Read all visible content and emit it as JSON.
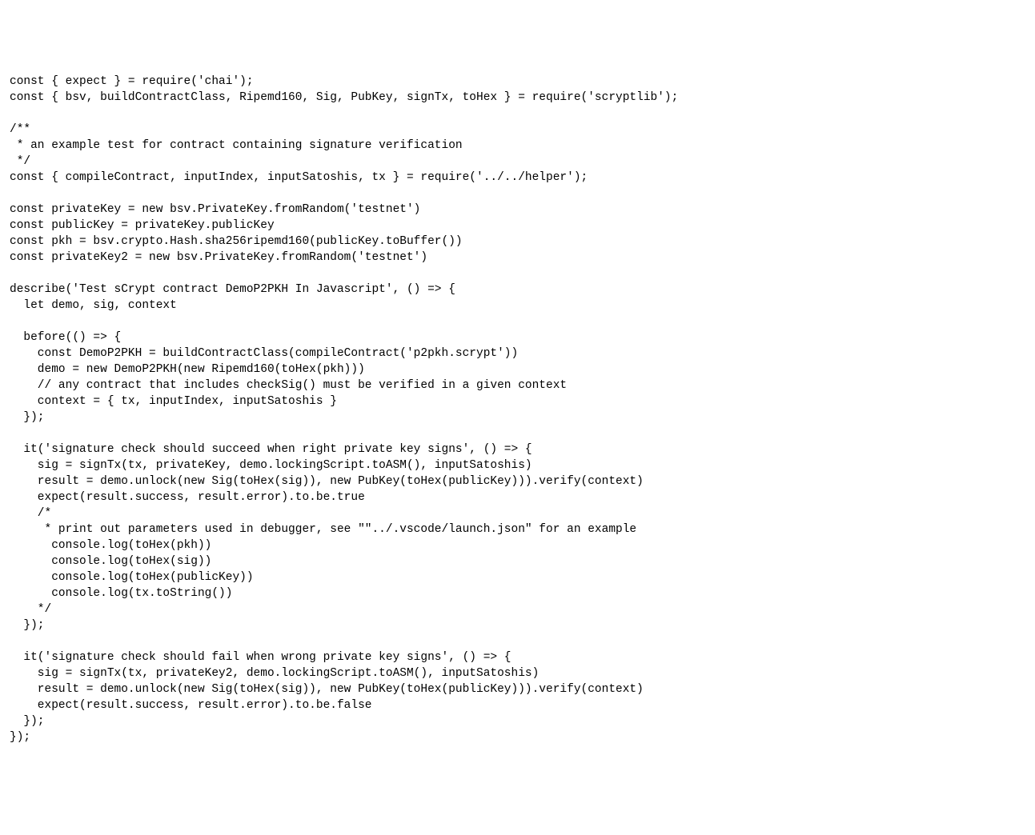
{
  "code": {
    "lines": [
      "const { expect } = require('chai');",
      "const { bsv, buildContractClass, Ripemd160, Sig, PubKey, signTx, toHex } = require('scryptlib');",
      "",
      "/**",
      " * an example test for contract containing signature verification",
      " */",
      "const { compileContract, inputIndex, inputSatoshis, tx } = require('../../helper');",
      "",
      "const privateKey = new bsv.PrivateKey.fromRandom('testnet')",
      "const publicKey = privateKey.publicKey",
      "const pkh = bsv.crypto.Hash.sha256ripemd160(publicKey.toBuffer())",
      "const privateKey2 = new bsv.PrivateKey.fromRandom('testnet')",
      "",
      "describe('Test sCrypt contract DemoP2PKH In Javascript', () => {",
      "  let demo, sig, context",
      "",
      "  before(() => {",
      "    const DemoP2PKH = buildContractClass(compileContract('p2pkh.scrypt'))",
      "    demo = new DemoP2PKH(new Ripemd160(toHex(pkh)))",
      "    // any contract that includes checkSig() must be verified in a given context",
      "    context = { tx, inputIndex, inputSatoshis }",
      "  });",
      "",
      "  it('signature check should succeed when right private key signs', () => {",
      "    sig = signTx(tx, privateKey, demo.lockingScript.toASM(), inputSatoshis)",
      "    result = demo.unlock(new Sig(toHex(sig)), new PubKey(toHex(publicKey))).verify(context)",
      "    expect(result.success, result.error).to.be.true",
      "    /*",
      "     * print out parameters used in debugger, see \"\"../.vscode/launch.json\" for an example",
      "      console.log(toHex(pkh))",
      "      console.log(toHex(sig))",
      "      console.log(toHex(publicKey))",
      "      console.log(tx.toString())",
      "    */",
      "  });",
      "",
      "  it('signature check should fail when wrong private key signs', () => {",
      "    sig = signTx(tx, privateKey2, demo.lockingScript.toASM(), inputSatoshis)",
      "    result = demo.unlock(new Sig(toHex(sig)), new PubKey(toHex(publicKey))).verify(context)",
      "    expect(result.success, result.error).to.be.false",
      "  });",
      "});"
    ]
  }
}
